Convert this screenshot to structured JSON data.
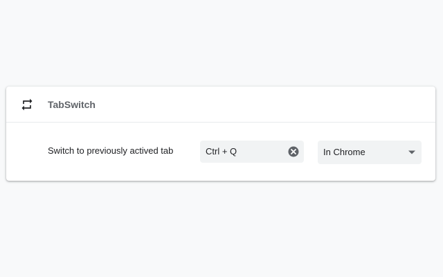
{
  "extension": {
    "name": "TabSwitch",
    "icon": "repeat-icon"
  },
  "command": {
    "description": "Switch to previously actived tab",
    "shortcut": "Ctrl + Q",
    "clear_icon": "clear-circle-icon",
    "scope": "In Chrome",
    "scope_icon": "dropdown-caret-icon"
  },
  "colors": {
    "page_background": "#f8f9fa",
    "card_background": "#ffffff",
    "field_background": "#f1f3f4",
    "title_text": "#5f6368",
    "body_text": "#202124",
    "icon": "#5f6368"
  }
}
